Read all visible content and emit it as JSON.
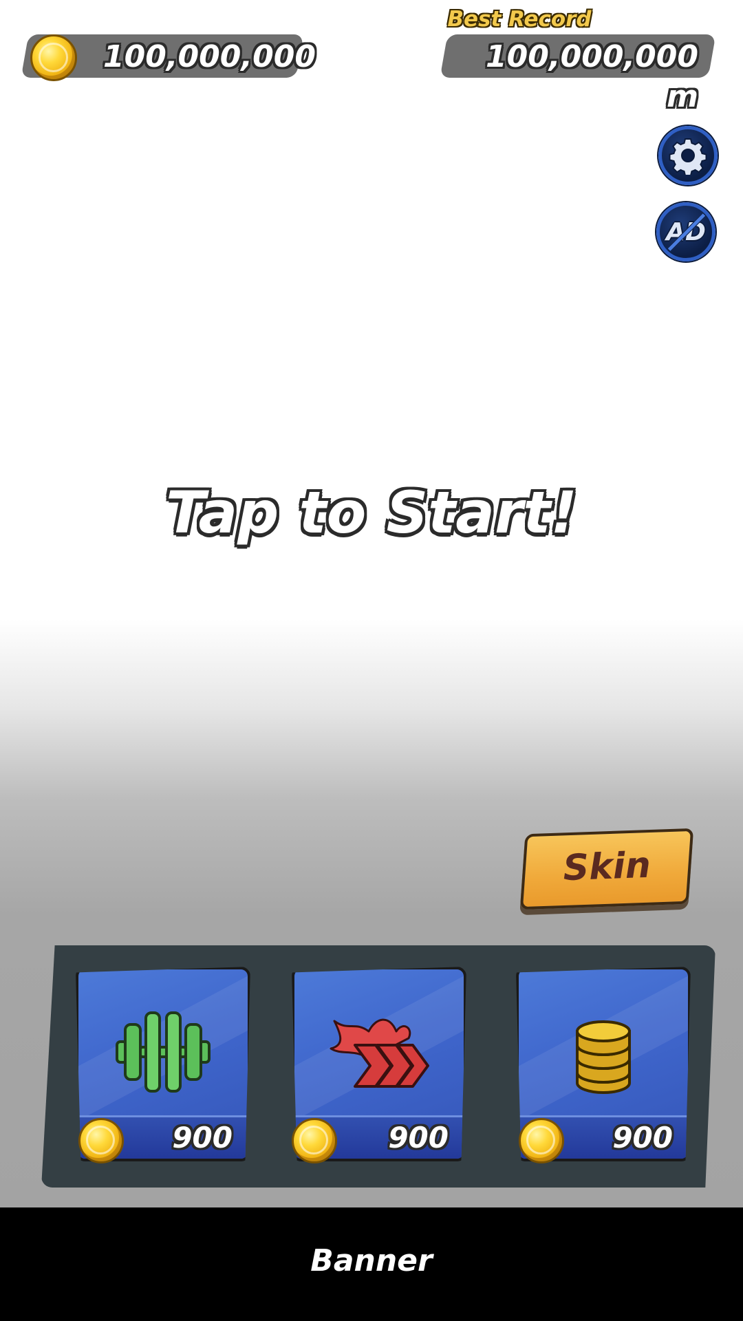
{
  "hud": {
    "coins": "100,000,000",
    "best_record_label": "Best Record",
    "best_record_value": "100,000,000 m",
    "coin_icon": "coin-icon"
  },
  "buttons": {
    "settings_icon": "gear-icon",
    "remove_ads_label": "AD",
    "remove_ads_icon": "no-ads-icon",
    "skin_label": "Skin"
  },
  "main": {
    "prompt": "Tap to Start!"
  },
  "upgrades": [
    {
      "icon": "dumbbell-icon",
      "price": "900"
    },
    {
      "icon": "speed-boost-icon",
      "price": "900"
    },
    {
      "icon": "coin-stack-icon",
      "price": "900"
    }
  ],
  "banner": {
    "label": "Banner"
  },
  "colors": {
    "card_blue": "#3f66cc",
    "panel": "#343f44",
    "skin_button": "#f0a93a",
    "record_label": "#f2c94c"
  }
}
